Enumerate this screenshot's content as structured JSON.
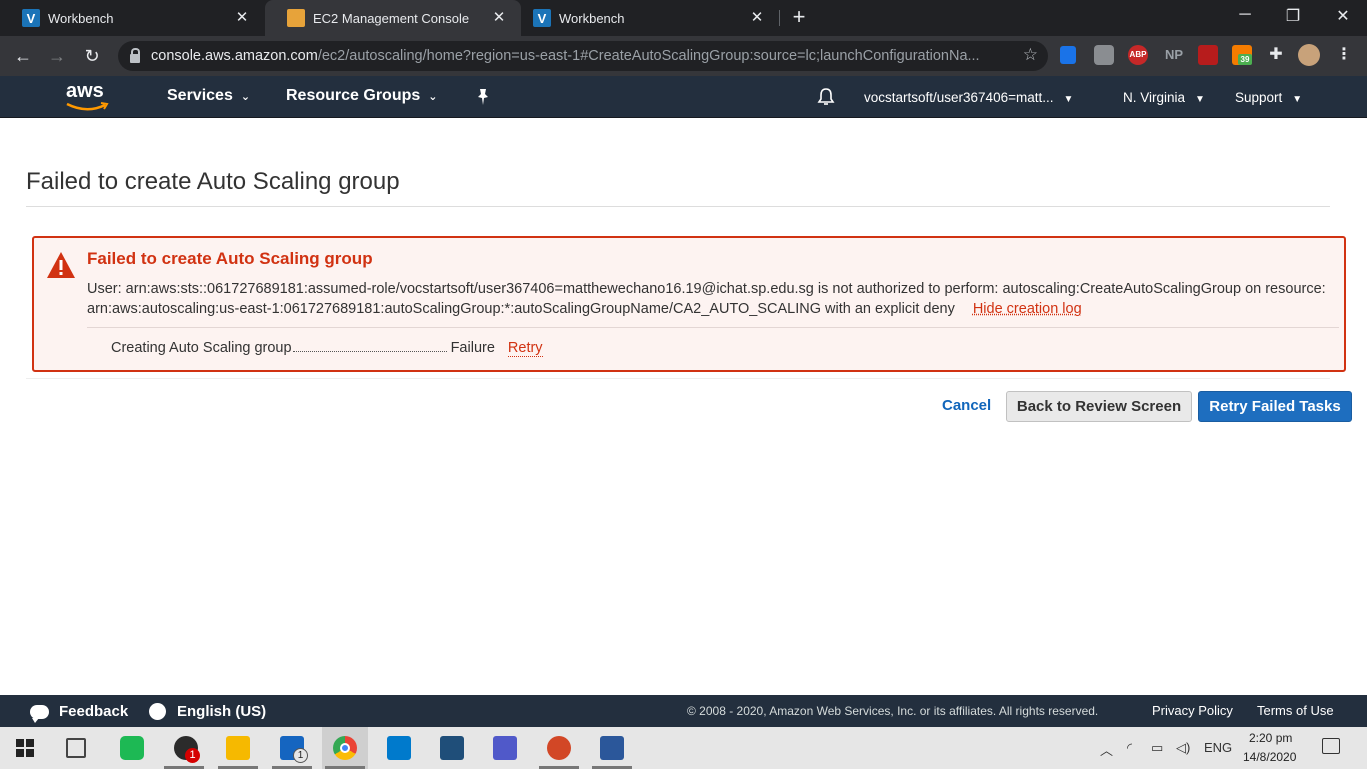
{
  "browser": {
    "tabs": [
      {
        "title": "Workbench",
        "icon": "V",
        "active": false
      },
      {
        "title": "EC2 Management Console",
        "icon": "aws-cube",
        "active": true
      },
      {
        "title": "Workbench",
        "icon": "V",
        "active": false
      }
    ],
    "url_host": "console.aws.amazon.com",
    "url_path": "/ec2/autoscaling/home?region=us-east-1#CreateAutoScalingGroup:source=lc;launchConfigurationNa...",
    "extensions": {
      "abp": "ABP",
      "np": "NP",
      "badge": "39"
    }
  },
  "aws_header": {
    "logo": "aws",
    "services": "Services",
    "resource_groups": "Resource Groups",
    "account": "vocstartsoft/user367406=matt...",
    "region": "N. Virginia",
    "support": "Support"
  },
  "page": {
    "title": "Failed to create Auto Scaling group",
    "error": {
      "title": "Failed to create Auto Scaling group",
      "message": "User: arn:aws:sts::061727689181:assumed-role/vocstartsoft/user367406=matthewechano16.19@ichat.sp.edu.sg is not authorized to perform: autoscaling:CreateAutoScalingGroup on resource: arn:aws:autoscaling:us-east-1:061727689181:autoScalingGroup:*:autoScalingGroupName/CA2_AUTO_SCALING with an explicit deny",
      "hide_log": "Hide creation log",
      "task_label": "Creating Auto Scaling group",
      "task_status": "Failure",
      "task_retry": "Retry"
    },
    "buttons": {
      "cancel": "Cancel",
      "back": "Back to Review Screen",
      "retry_failed": "Retry Failed Tasks"
    }
  },
  "aws_footer": {
    "feedback": "Feedback",
    "language": "English (US)",
    "copyright": "© 2008 - 2020, Amazon Web Services, Inc. or its affiliates. All rights reserved.",
    "privacy": "Privacy Policy",
    "terms": "Terms of Use"
  },
  "taskbar": {
    "whatsapp_badge": "1",
    "mail_badge": "1",
    "lang": "ENG",
    "time": "2:20 pm",
    "date": "14/8/2020"
  },
  "colors": {
    "aws_nav": "#232f3e",
    "error_red": "#d13212",
    "primary_blue": "#1e6ebf",
    "link_blue": "#1166bb"
  }
}
